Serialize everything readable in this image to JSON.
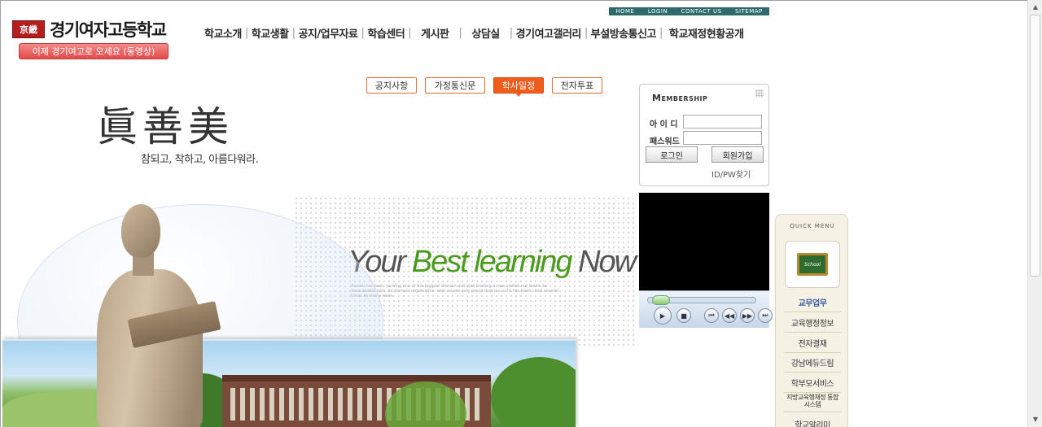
{
  "header": {
    "logo_mark": "京畿",
    "school_name": "경기여자고등학교",
    "video_button": "이제 경기여고로 오세요 (동영상)"
  },
  "utility": [
    "HOME",
    "LOGIN",
    "CONTACT US",
    "SITEMAP"
  ],
  "nav": [
    "학교소개",
    "학교생활",
    "공지/업무자료",
    "학습센터",
    "게시판",
    "상담실",
    "경기여고갤러리",
    "부설방송통신고",
    "학교재정현황공개"
  ],
  "tabs": [
    {
      "label": "공지사항",
      "active": false
    },
    {
      "label": "가정통신문",
      "active": false
    },
    {
      "label": "학사일정",
      "active": true
    },
    {
      "label": "전자투표",
      "active": false
    }
  ],
  "hero": {
    "hanja": "眞善美",
    "motto": "참되고, 착하고, 아름다워라.",
    "slogan_part1": "Your ",
    "slogan_part2": "Best learning",
    "slogan_part3": " Now",
    "small_text": "Asadal has been running one of the biggest domain and web hosting a new visited our leads. be www.asadal.com, for domain registration, web no are very proud that our ai to has been cited several times by many news"
  },
  "membership": {
    "title": "Membership",
    "id_label": "아 이 디",
    "pw_label": "패스워드",
    "id_value": "",
    "pw_value": "",
    "login_button": "로그인",
    "join_button": "회원가입",
    "find_link": "ID/PW찾기"
  },
  "player": {
    "progress": 0.05
  },
  "quick_menu": {
    "title": "QUICK MENU",
    "board_text": "School",
    "items": [
      "교무업무",
      "교육행정정보",
      "전자결재",
      "강남에듀드림",
      "학부모서비스",
      "지방교육행재정 통합시스템",
      "학교알리미"
    ]
  }
}
